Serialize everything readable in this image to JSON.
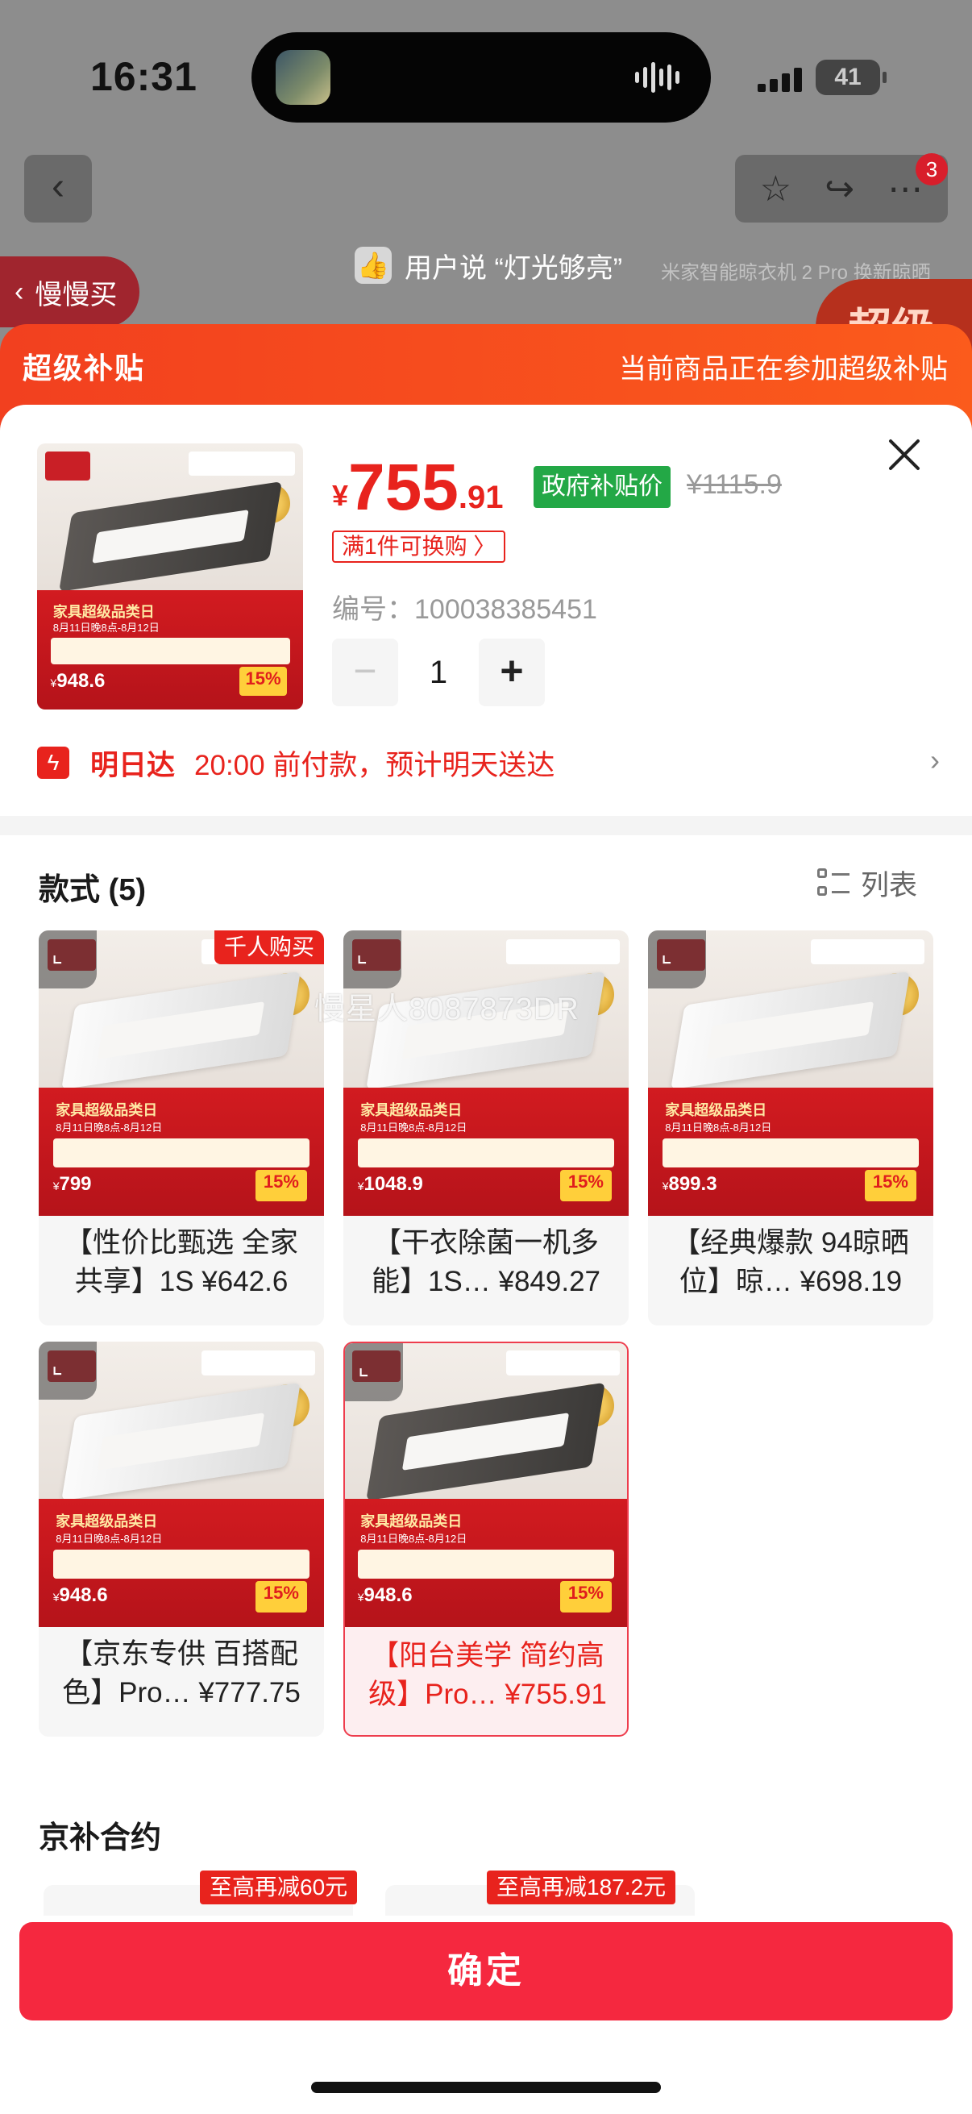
{
  "status": {
    "time": "16:31",
    "battery": "41"
  },
  "background": {
    "slow_buy": "慢慢买",
    "user_says": "用户说 “灯光够亮”",
    "product_title": "米家智能晾衣机 2 Pro 换新晾晒",
    "badge": "超级",
    "cart_count": "3"
  },
  "subsidy": {
    "title": "超级补贴",
    "desc": "当前商品正在参加超级补贴"
  },
  "product": {
    "price_symbol": "¥",
    "price_int": "755",
    "price_dec": ".91",
    "gov_tag": "政府补贴价",
    "orig_price": "¥1115.9",
    "exchange": "满1件可换购 〉",
    "code_label": "编号：",
    "code": "100038385451",
    "quantity": "1",
    "image_title": "家具超级品类日",
    "image_date": "8月11日晚8点-8月12日",
    "image_price": "948.6",
    "image_pct": "15%"
  },
  "delivery": {
    "label": "明日达",
    "text": "20:00 前付款，预计明天送达"
  },
  "styles": {
    "title": "款式 (5)",
    "list_label": "列表",
    "items": [
      {
        "name": "【性价比甄选 全家共享】1S ¥642.6",
        "hot": "千人购买",
        "img_price": "799",
        "lamp": "white"
      },
      {
        "name": "【干衣除菌一机多能】1S… ¥849.27",
        "hot": "",
        "img_price": "1048.9",
        "lamp": "white"
      },
      {
        "name": "【经典爆款 94晾晒位】晾… ¥698.19",
        "hot": "",
        "img_price": "899.3",
        "lamp": "white"
      },
      {
        "name": "【京东专供 百搭配色】Pro… ¥777.75",
        "hot": "",
        "img_price": "948.6",
        "lamp": "white"
      },
      {
        "name": "【阳台美学 简约高级】Pro… ¥755.91",
        "hot": "",
        "img_price": "948.6",
        "lamp": "dark",
        "selected": true
      }
    ]
  },
  "watermark": "慢星人8087873DR",
  "jingbu": {
    "title": "京补合约",
    "tag1": "至高再减60元",
    "tag2": "至高再减187.2元"
  },
  "confirm_label": "确定"
}
